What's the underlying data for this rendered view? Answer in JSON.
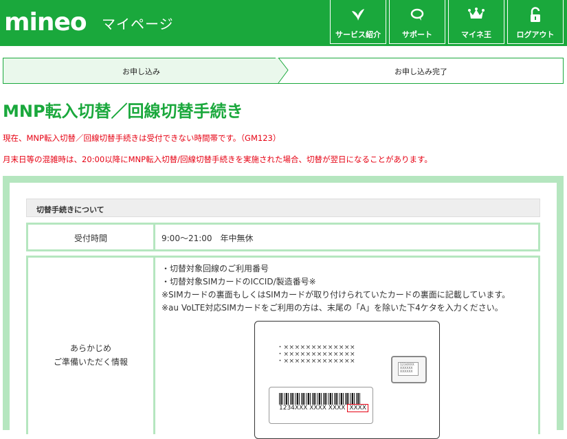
{
  "header": {
    "logo": "mineo",
    "subtitle": "マイページ",
    "nav": [
      {
        "label": "サービス紹介",
        "icon": "heart-sprout-icon"
      },
      {
        "label": "サポート",
        "icon": "chat-bubble-icon"
      },
      {
        "label": "マイネ王",
        "icon": "crown-icon"
      },
      {
        "label": "ログアウト",
        "icon": "unlock-icon"
      }
    ]
  },
  "steps": {
    "step1": "お申し込み",
    "step2": "お申し込み完了",
    "current": 1
  },
  "page_title": "MNP転入切替／回線切替手続き",
  "notices": [
    "現在、MNP転入切替／回線切替手続きは受付できない時間帯です。（GM123）",
    "月末日等の混雑時は、20:00以降にMNP転入切替/回線切替手続きを実施された場合、切替が翌日になることがあります。"
  ],
  "section": {
    "heading": "切替手続きについて",
    "rows": [
      {
        "label": "受付時間",
        "value": "9:00〜21:00　年中無休"
      },
      {
        "label_line1": "あらかじめ",
        "label_line2": "ご準備いただく情報",
        "lines": [
          "・切替対象回線のご利用番号",
          "・切替対象SIMカードのICCID/製造番号※",
          "※SIMカードの裏面もしくはSIMカードが取り付けられていたカードの裏面に記載しています。",
          "※au VoLTE対応SIMカードをご利用の方は、末尾の「A」を除いた下4ケタを入力ください。"
        ]
      }
    ]
  },
  "card": {
    "x_lines": [
      "・×××××××××××××",
      "・×××××××××××××",
      "・×××××××××××××"
    ],
    "chip_text": [
      "1234XXX",
      "XXXXXX",
      "XXXXXX"
    ],
    "barcode_number": "1234XXX XXXX XXXX",
    "highlight": "XXXX",
    "highlight_color": "#e60012"
  },
  "colors": {
    "brand": "#1aa83c",
    "notice": "#e60012",
    "panel": "#b5e6bf"
  }
}
